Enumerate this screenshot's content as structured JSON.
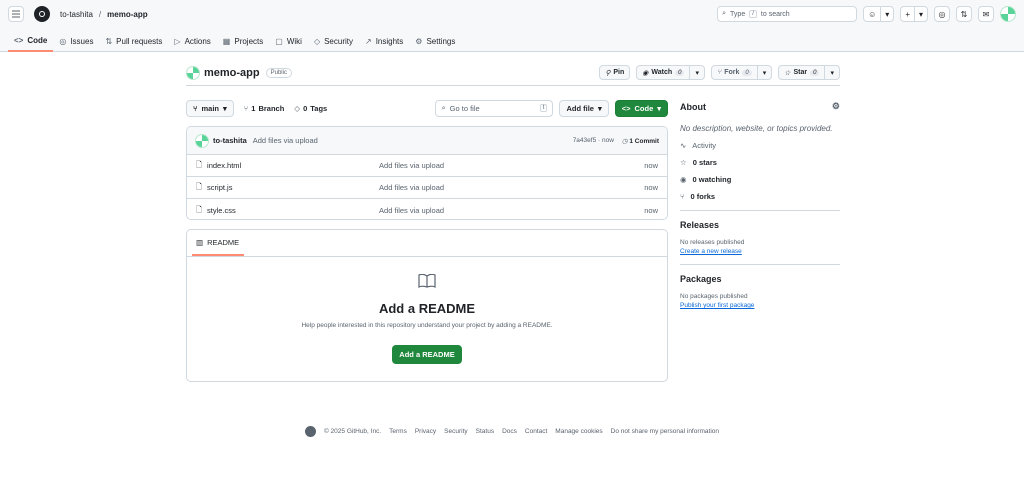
{
  "header": {
    "owner": "to-tashita",
    "separator": "/",
    "repo": "memo-app",
    "search_label": "Type",
    "search_key": "/",
    "search_suffix": "to search"
  },
  "tabs": [
    {
      "label": "Code",
      "icon": "<>"
    },
    {
      "label": "Issues",
      "icon": "◎"
    },
    {
      "label": "Pull requests",
      "icon": "⇅"
    },
    {
      "label": "Actions",
      "icon": "▷"
    },
    {
      "label": "Projects",
      "icon": "▦"
    },
    {
      "label": "Wiki",
      "icon": "▢"
    },
    {
      "label": "Security",
      "icon": "◇"
    },
    {
      "label": "Insights",
      "icon": "↗"
    },
    {
      "label": "Settings",
      "icon": "⚙"
    }
  ],
  "repo_header": {
    "name": "memo-app",
    "visibility": "Public",
    "pin": "Pin",
    "watch": "Watch",
    "watch_count": "0",
    "fork": "Fork",
    "fork_count": "0",
    "star": "Star",
    "star_count": "0"
  },
  "toolbar": {
    "branch": "main",
    "branch_count": "1",
    "branch_label": "Branch",
    "tag_count": "0",
    "tag_label": "Tags",
    "go_to_file": "Go to file",
    "go_key": "t",
    "add_file": "Add file",
    "code": "Code"
  },
  "commit": {
    "user": "to-tashita",
    "message": "Add files via upload",
    "hash": "7a43ef5 · now",
    "commit_count": "1 Commit"
  },
  "files": [
    {
      "name": "index.html",
      "message": "Add files via upload",
      "time": "now"
    },
    {
      "name": "script.js",
      "message": "Add files via upload",
      "time": "now"
    },
    {
      "name": "style.css",
      "message": "Add files via upload",
      "time": "now"
    }
  ],
  "readme": {
    "tab": "README",
    "title": "Add a README",
    "description": "Help people interested in this repository understand your project by adding a README.",
    "button": "Add a README"
  },
  "about": {
    "title": "About",
    "description": "No description, website, or topics provided.",
    "activity": "Activity",
    "stars": "0 stars",
    "watching": "0 watching",
    "forks": "0 forks"
  },
  "releases": {
    "title": "Releases",
    "none": "No releases published",
    "link": "Create a new release"
  },
  "packages": {
    "title": "Packages",
    "none": "No packages published",
    "link": "Publish your first package"
  },
  "footer": {
    "copyright": "© 2025 GitHub, Inc.",
    "links": [
      "Terms",
      "Privacy",
      "Security",
      "Status",
      "Docs",
      "Contact",
      "Manage cookies",
      "Do not share my personal information"
    ]
  }
}
